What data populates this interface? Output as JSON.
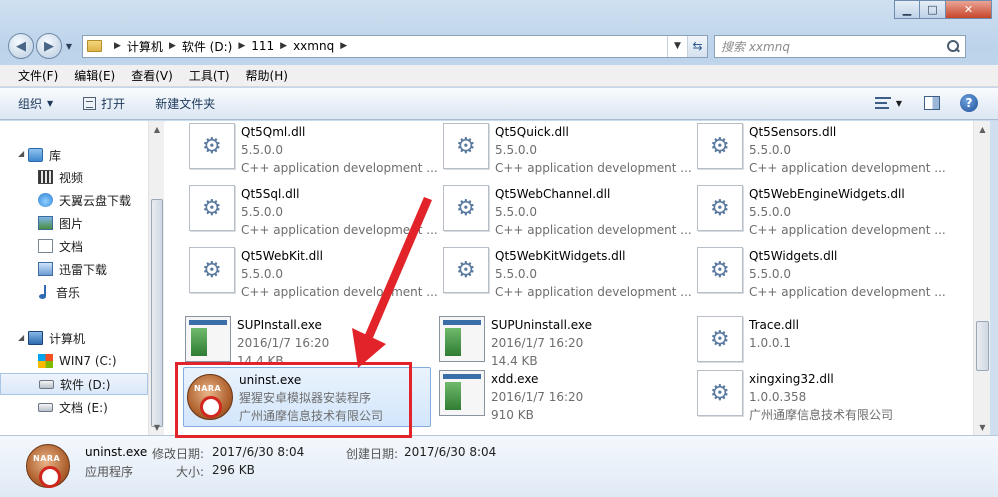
{
  "address": {
    "crumbs": [
      "计算机",
      "软件 (D:)",
      "111",
      "xxmnq"
    ],
    "search_placeholder": "搜索 xxmnq"
  },
  "menu": [
    "文件(F)",
    "编辑(E)",
    "查看(V)",
    "工具(T)",
    "帮助(H)"
  ],
  "toolbar": {
    "organize": "组织",
    "open": "打开",
    "new_folder": "新建文件夹"
  },
  "sidebar": {
    "library": "库",
    "library_items": [
      "视频",
      "天翼云盘下载",
      "图片",
      "文档",
      "迅雷下载",
      "音乐"
    ],
    "computer": "计算机",
    "drives": [
      "WIN7 (C:)",
      "软件 (D:)",
      "文档 (E:)"
    ]
  },
  "files": [
    {
      "name": "Qt5Qml.dll",
      "line2": "5.5.0.0",
      "line3": "C++ application development ...",
      "icon": "dll-icon"
    },
    {
      "name": "Qt5Quick.dll",
      "line2": "5.5.0.0",
      "line3": "C++ application development ...",
      "icon": "dll-icon"
    },
    {
      "name": "Qt5Sensors.dll",
      "line2": "5.5.0.0",
      "line3": "C++ application development ...",
      "icon": "dll-icon"
    },
    {
      "name": "Qt5Sql.dll",
      "line2": "5.5.0.0",
      "line3": "C++ application development ...",
      "icon": "dll-icon"
    },
    {
      "name": "Qt5WebChannel.dll",
      "line2": "5.5.0.0",
      "line3": "C++ application development ...",
      "icon": "dll-icon"
    },
    {
      "name": "Qt5WebEngineWidgets.dll",
      "line2": "5.5.0.0",
      "line3": "C++ application development ...",
      "icon": "dll-icon"
    },
    {
      "name": "Qt5WebKit.dll",
      "line2": "5.5.0.0",
      "line3": "C++ application development ...",
      "icon": "dll-icon"
    },
    {
      "name": "Qt5WebKitWidgets.dll",
      "line2": "5.5.0.0",
      "line3": "C++ application development ...",
      "icon": "dll-icon"
    },
    {
      "name": "Qt5Widgets.dll",
      "line2": "5.5.0.0",
      "line3": "C++ application development ...",
      "icon": "dll-icon"
    },
    {
      "name": "SUPInstall.exe",
      "line2": "2016/1/7 16:20",
      "line3": "14.4 KB",
      "icon": "exe-icon"
    },
    {
      "name": "SUPUninstall.exe",
      "line2": "2016/1/7 16:20",
      "line3": "14.4 KB",
      "icon": "exe-icon"
    },
    {
      "name": "Trace.dll",
      "line2": "1.0.0.1",
      "line3": "",
      "icon": "dll-icon"
    },
    {
      "name": "uninst.exe",
      "line2": "猩猩安卓模拟器安装程序",
      "line3": "广州通摩信息技术有限公司",
      "icon": "nara-uninstall-icon"
    },
    {
      "name": "xdd.exe",
      "line2": "2016/1/7 16:20",
      "line3": "910 KB",
      "icon": "exe-icon"
    },
    {
      "name": "xingxing32.dll",
      "line2": "1.0.0.358",
      "line3": "广州通摩信息技术有限公司",
      "icon": "dll-icon"
    }
  ],
  "details": {
    "name": "uninst.exe",
    "type": "应用程序",
    "modified_label": "修改日期:",
    "modified_value": "2017/6/30 8:04",
    "created_label": "创建日期:",
    "created_value": "2017/6/30 8:04",
    "size_label": "大小:",
    "size_value": "296 KB"
  },
  "colors": {
    "annotation": "#e2242a",
    "selection": "#d3e6fb"
  }
}
